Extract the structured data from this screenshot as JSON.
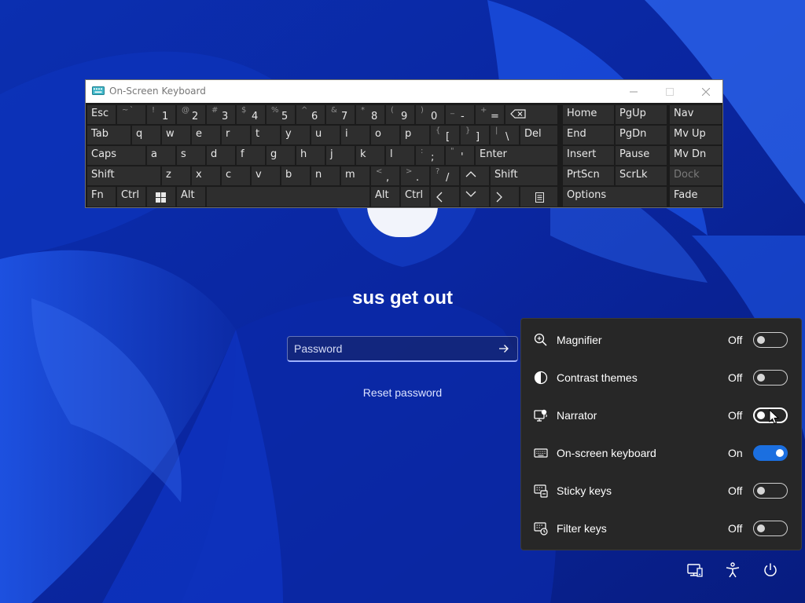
{
  "lock_screen": {
    "user_name": "sus get out",
    "password_placeholder": "Password",
    "reset_password": "Reset password",
    "submit_icon": "arrow-right-icon"
  },
  "osk": {
    "title": "On-Screen Keyboard",
    "icons": {
      "app": "keyboard-app-icon",
      "minimize": "minimize-icon",
      "maximize": "maximize-icon",
      "close": "close-icon"
    },
    "keys": {
      "esc": "Esc",
      "tilde_shift": "~",
      "tilde_base": "`",
      "k1_shift": "!",
      "k1": "1",
      "k2_shift": "@",
      "k2": "2",
      "k3_shift": "#",
      "k3": "3",
      "k4_shift": "$",
      "k4": "4",
      "k5_shift": "%",
      "k5": "5",
      "k6_shift": "^",
      "k6": "6",
      "k7_shift": "&",
      "k7": "7",
      "k8_shift": "*",
      "k8": "8",
      "k9_shift": "(",
      "k9": "9",
      "k0_shift": ")",
      "k0": "0",
      "minus_shift": "_",
      "minus": "-",
      "equals_shift": "+",
      "equals": "=",
      "tab": "Tab",
      "q": "q",
      "w": "w",
      "e": "e",
      "r": "r",
      "t": "t",
      "y": "y",
      "u": "u",
      "i": "i",
      "o": "o",
      "p": "p",
      "lbracket_shift": "{",
      "lbracket": "[",
      "rbracket_shift": "}",
      "rbracket": "]",
      "backslash_shift": "|",
      "backslash": "\\",
      "del": "Del",
      "caps": "Caps",
      "a": "a",
      "s": "s",
      "d": "d",
      "f": "f",
      "g": "g",
      "h": "h",
      "j": "j",
      "k": "k",
      "l": "l",
      "semicolon_shift": ":",
      "semicolon": ";",
      "quote_shift": "\"",
      "quote": "'",
      "enter": "Enter",
      "shift": "Shift",
      "z": "z",
      "x": "x",
      "c": "c",
      "v": "v",
      "b": "b",
      "n": "n",
      "m": "m",
      "comma_shift": "<",
      "comma": ",",
      "period_shift": ">",
      "period": ".",
      "slash_shift": "?",
      "slash": "/",
      "fn": "Fn",
      "ctrl": "Ctrl",
      "alt": "Alt",
      "home": "Home",
      "pgup": "PgUp",
      "nav": "Nav",
      "end": "End",
      "pgdn": "PgDn",
      "mvup": "Mv Up",
      "insert": "Insert",
      "pause": "Pause",
      "mvdn": "Mv Dn",
      "prtscn": "PrtScn",
      "scrlk": "ScrLk",
      "dock": "Dock",
      "options": "Options",
      "fade": "Fade"
    }
  },
  "accessibility_panel": {
    "items": [
      {
        "label": "Magnifier",
        "state": "Off",
        "on": false,
        "icon": "magnifier-icon"
      },
      {
        "label": "Contrast themes",
        "state": "Off",
        "on": false,
        "icon": "contrast-icon"
      },
      {
        "label": "Narrator",
        "state": "Off",
        "on": false,
        "icon": "narrator-icon"
      },
      {
        "label": "On-screen keyboard",
        "state": "On",
        "on": true,
        "icon": "keyboard-icon"
      },
      {
        "label": "Sticky keys",
        "state": "Off",
        "on": false,
        "icon": "sticky-keys-icon"
      },
      {
        "label": "Filter keys",
        "state": "Off",
        "on": false,
        "icon": "filter-keys-icon"
      }
    ]
  },
  "system_icons": [
    "network-icon",
    "accessibility-icon",
    "power-icon"
  ],
  "colors": {
    "toggle_on": "#1b6fe0",
    "panel_bg": "#272727",
    "key_bg": "#2e2e2e",
    "wallpaper": "#0a2a9c"
  }
}
